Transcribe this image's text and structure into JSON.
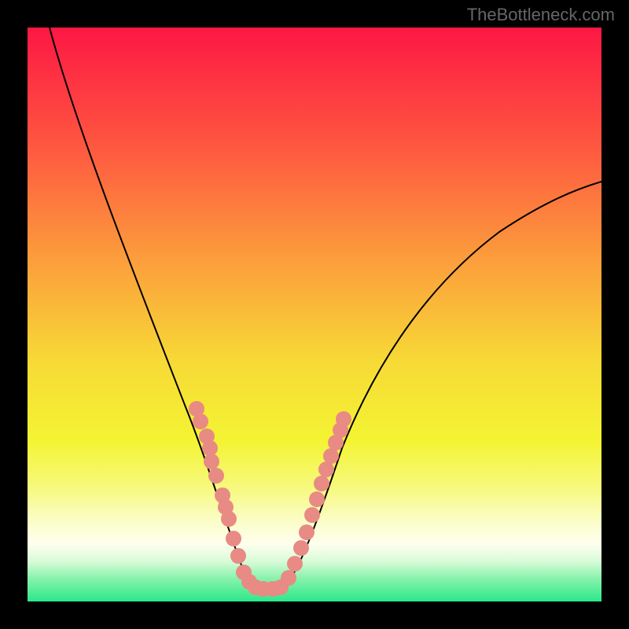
{
  "watermark": "TheBottleneck.com",
  "chart_data": {
    "type": "line",
    "title": "",
    "xlabel": "",
    "ylabel": "",
    "xlim": [
      0,
      100
    ],
    "ylim": [
      0,
      100
    ],
    "curve": {
      "description": "V-shaped bottleneck curve with minimum near x≈37. Left branch descends steeply from top-left; right branch rises concavely toward the right. Y-axis is inverted visually (high values at top).",
      "x": [
        3,
        6,
        9,
        12,
        15,
        18,
        21,
        24,
        27,
        30,
        33,
        36,
        37,
        38,
        41,
        44,
        47,
        50,
        53,
        56,
        59,
        62,
        65,
        68,
        71,
        74,
        77,
        80,
        83,
        86,
        89,
        92,
        95,
        98
      ],
      "y": [
        100,
        94,
        88,
        82,
        76,
        69,
        63,
        56,
        48,
        41,
        32,
        18,
        0,
        6,
        18,
        27,
        33,
        38,
        43,
        47,
        50,
        53,
        56,
        58,
        60,
        62,
        64,
        66,
        67,
        69,
        70,
        71,
        72,
        73
      ]
    },
    "markers": {
      "description": "Salmon-pink dots on both branches near the bottom quarter of the chart marking data points.",
      "color": "#e88b84",
      "radius": 10,
      "points_svg": [
        [
          215,
          485
        ],
        [
          220,
          501
        ],
        [
          228,
          520
        ],
        [
          232,
          535
        ],
        [
          234,
          552
        ],
        [
          240,
          570
        ],
        [
          248,
          595
        ],
        [
          252,
          610
        ],
        [
          256,
          625
        ],
        [
          262,
          650
        ],
        [
          268,
          672
        ],
        [
          275,
          693
        ],
        [
          282,
          705
        ],
        [
          290,
          712
        ],
        [
          300,
          714
        ],
        [
          312,
          714
        ],
        [
          322,
          712
        ],
        [
          332,
          700
        ],
        [
          340,
          682
        ],
        [
          348,
          662
        ],
        [
          355,
          642
        ],
        [
          362,
          620
        ],
        [
          368,
          600
        ],
        [
          374,
          580
        ],
        [
          380,
          562
        ],
        [
          386,
          545
        ],
        [
          392,
          528
        ],
        [
          398,
          512
        ],
        [
          402,
          498
        ]
      ]
    },
    "gradient_stops": [
      {
        "offset": 0.0,
        "color": "#fd1744"
      },
      {
        "offset": 0.2,
        "color": "#fe5540"
      },
      {
        "offset": 0.4,
        "color": "#fc9c3c"
      },
      {
        "offset": 0.58,
        "color": "#f7d936"
      },
      {
        "offset": 0.72,
        "color": "#f4f433"
      },
      {
        "offset": 0.8,
        "color": "#f6f97c"
      },
      {
        "offset": 0.86,
        "color": "#fbfdc8"
      },
      {
        "offset": 0.9,
        "color": "#feffee"
      },
      {
        "offset": 0.93,
        "color": "#d8fbd8"
      },
      {
        "offset": 0.96,
        "color": "#88f2ac"
      },
      {
        "offset": 1.0,
        "color": "#2be88b"
      }
    ]
  }
}
